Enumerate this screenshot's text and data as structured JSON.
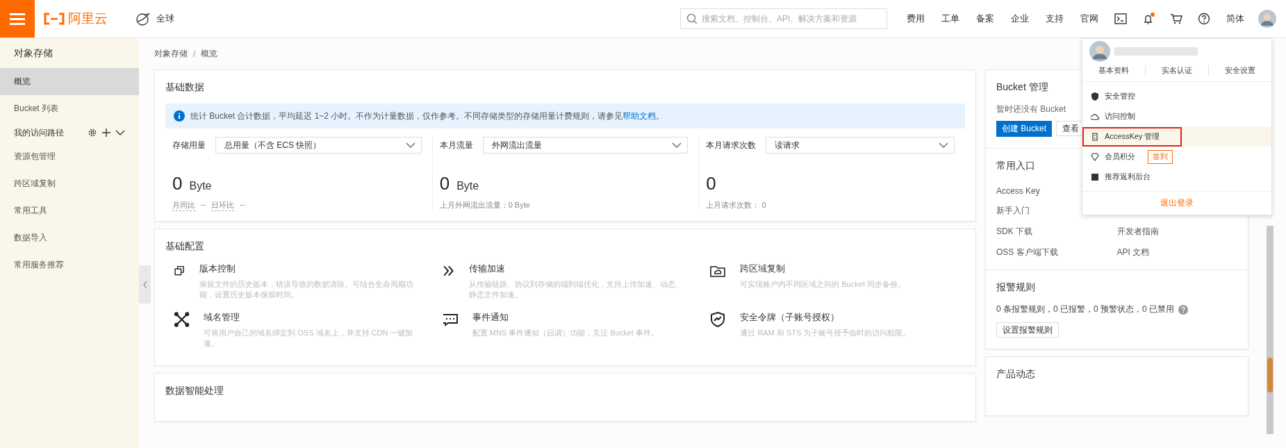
{
  "topbar": {
    "brand": "阿里云",
    "region": "全球",
    "search": {
      "placeholder": "搜索文档、控制台、API、解决方案和资源"
    },
    "nav": [
      "费用",
      "工单",
      "备案",
      "企业",
      "支持",
      "官网"
    ],
    "tools": [
      {
        "kind": "terminal"
      },
      {
        "kind": "bell",
        "badge": true
      },
      {
        "kind": "cart"
      },
      {
        "kind": "help"
      }
    ],
    "language": "简体"
  },
  "sidebar": {
    "title": "对象存储",
    "items": [
      {
        "label": "概览",
        "kind": "link",
        "selected": true
      },
      {
        "label": "Bucket 列表",
        "kind": "link",
        "selected": false
      },
      {
        "label": "我的访问路径",
        "kind": "group",
        "selected": false
      },
      {
        "label": "资源包管理",
        "kind": "link",
        "selected": false
      },
      {
        "label": "跨区域复制",
        "kind": "link",
        "selected": false
      },
      {
        "label": "常用工具",
        "kind": "link",
        "selected": false
      },
      {
        "label": "数据导入",
        "kind": "link",
        "selected": false
      },
      {
        "label": "常用服务推荐",
        "kind": "link",
        "selected": false
      }
    ]
  },
  "breadcrumb": [
    "对象存储",
    "概览"
  ],
  "breadcrumb_separator": "/",
  "basic_data": {
    "title": "基础数据",
    "notice": "统计 Bucket 合计数据，平均延迟 1~2 小时。不作为计量数据，仅作参考。不同存储类型的存储用量计费规则，请参见",
    "notice_link": "帮助文档",
    "notice_end": "。",
    "stats": [
      {
        "label": "存储用量",
        "select": "总用量（不含 ECS 快照）",
        "value": "0",
        "unit": "Byte",
        "compare": [
          {
            "label": "月同比",
            "value": "--"
          },
          {
            "label": "日环比",
            "value": "--"
          }
        ]
      },
      {
        "label": "本月流量",
        "select": "外网流出流量",
        "value": "0",
        "unit": "Byte",
        "note": "上月外网流出流量：0 Byte"
      },
      {
        "label": "本月请求次数",
        "select": "读请求",
        "value": "0",
        "note": "上月请求次数： 0"
      }
    ]
  },
  "basic_config": {
    "title": "基础配置",
    "items": [
      {
        "kind": "versions",
        "title": "版本控制",
        "desc": "保留文件的历史版本，错误导致的数据清除。可结合生命周期功能，设置历史版本保留时间。"
      },
      {
        "kind": "accelerate",
        "title": "传输加速",
        "desc": "从传输链路、协议到存储的端到端优化，支持上传加速、动态、静态文件加速。"
      },
      {
        "kind": "replicate",
        "title": "跨区域复制",
        "desc": "可实现账户内不同区域之间的 Bucket 同步备份。"
      },
      {
        "kind": "domain",
        "title": "域名管理",
        "desc": "可将用户自己的域名绑定到 OSS 域名上，并支持 CDN 一键加速。"
      },
      {
        "kind": "event",
        "title": "事件通知",
        "desc": "配置 MNS 事件通知（回调）功能，关注 Bucket 事件。"
      },
      {
        "kind": "token",
        "title": "安全令牌（子账号授权）",
        "desc": "通过 RAM 和 STS 为子账号授予临时的访问权限。"
      }
    ]
  },
  "next_card": {
    "title": "数据智能处理"
  },
  "bucket": {
    "title": "Bucket 管理",
    "empty": "暂时还没有 Bucket",
    "create": "创建 Bucket",
    "view": "查看"
  },
  "entries": {
    "title": "常用入口",
    "rows": [
      {
        "left": "Access Key"
      },
      {
        "left": "新手入门"
      },
      {
        "left": "SDK 下载",
        "right": "开发者指南"
      },
      {
        "left": "OSS 客户端下载",
        "right": "API 文档"
      }
    ]
  },
  "alarms": {
    "title": "报警规则",
    "summary": "0 条报警规则，0 已报警，0 预警状态，0 已禁用",
    "button": "设置报警规则"
  },
  "news": {
    "title": "产品动态"
  },
  "account_menu": {
    "links": [
      "基本资料",
      "实名认证",
      "安全设置"
    ],
    "items": [
      {
        "kind": "shield",
        "label": "安全管控",
        "selected": false
      },
      {
        "kind": "cloud",
        "label": "访问控制",
        "selected": false
      },
      {
        "kind": "key",
        "label": "AccessKey 管理",
        "selected": true
      },
      {
        "kind": "diamond",
        "label": "会员积分",
        "selected": false,
        "action": "签到"
      },
      {
        "kind": "gift",
        "label": "推荐返利后台",
        "selected": false
      }
    ],
    "logout": "退出登录"
  }
}
